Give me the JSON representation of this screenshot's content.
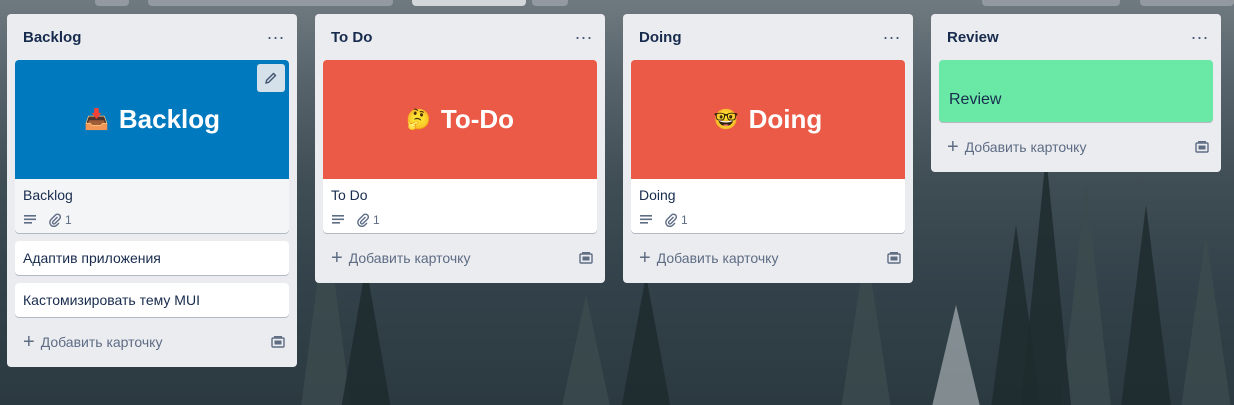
{
  "lists": [
    {
      "title": "Backlog",
      "cover_card": {
        "cover_text": "Backlog",
        "cover_emoji": "📥",
        "cover_color": "#0079bf",
        "title": "Backlog",
        "attachments": "1"
      },
      "cards": [
        "Адаптив приложения",
        "Кастомизировать тему MUI"
      ],
      "add_label": "Добавить карточку"
    },
    {
      "title": "To Do",
      "cover_card": {
        "cover_text": "To-Do",
        "cover_emoji": "🤔",
        "cover_color": "#eb5a46",
        "title": "To Do",
        "attachments": "1"
      },
      "add_label": "Добавить карточку"
    },
    {
      "title": "Doing",
      "cover_card": {
        "cover_text": "Doing",
        "cover_emoji": "🤓",
        "cover_color": "#eb5a46",
        "title": "Doing",
        "attachments": "1"
      },
      "add_label": "Добавить карточку"
    },
    {
      "title": "Review",
      "label_card": {
        "text": "Review",
        "color": "#6ae9a6"
      },
      "add_label": "Добавить карточку"
    }
  ],
  "icons": {
    "menu": "more-icon",
    "description": "description-icon",
    "attachment": "paperclip-icon",
    "template": "card-template-icon",
    "edit": "pencil-icon"
  }
}
